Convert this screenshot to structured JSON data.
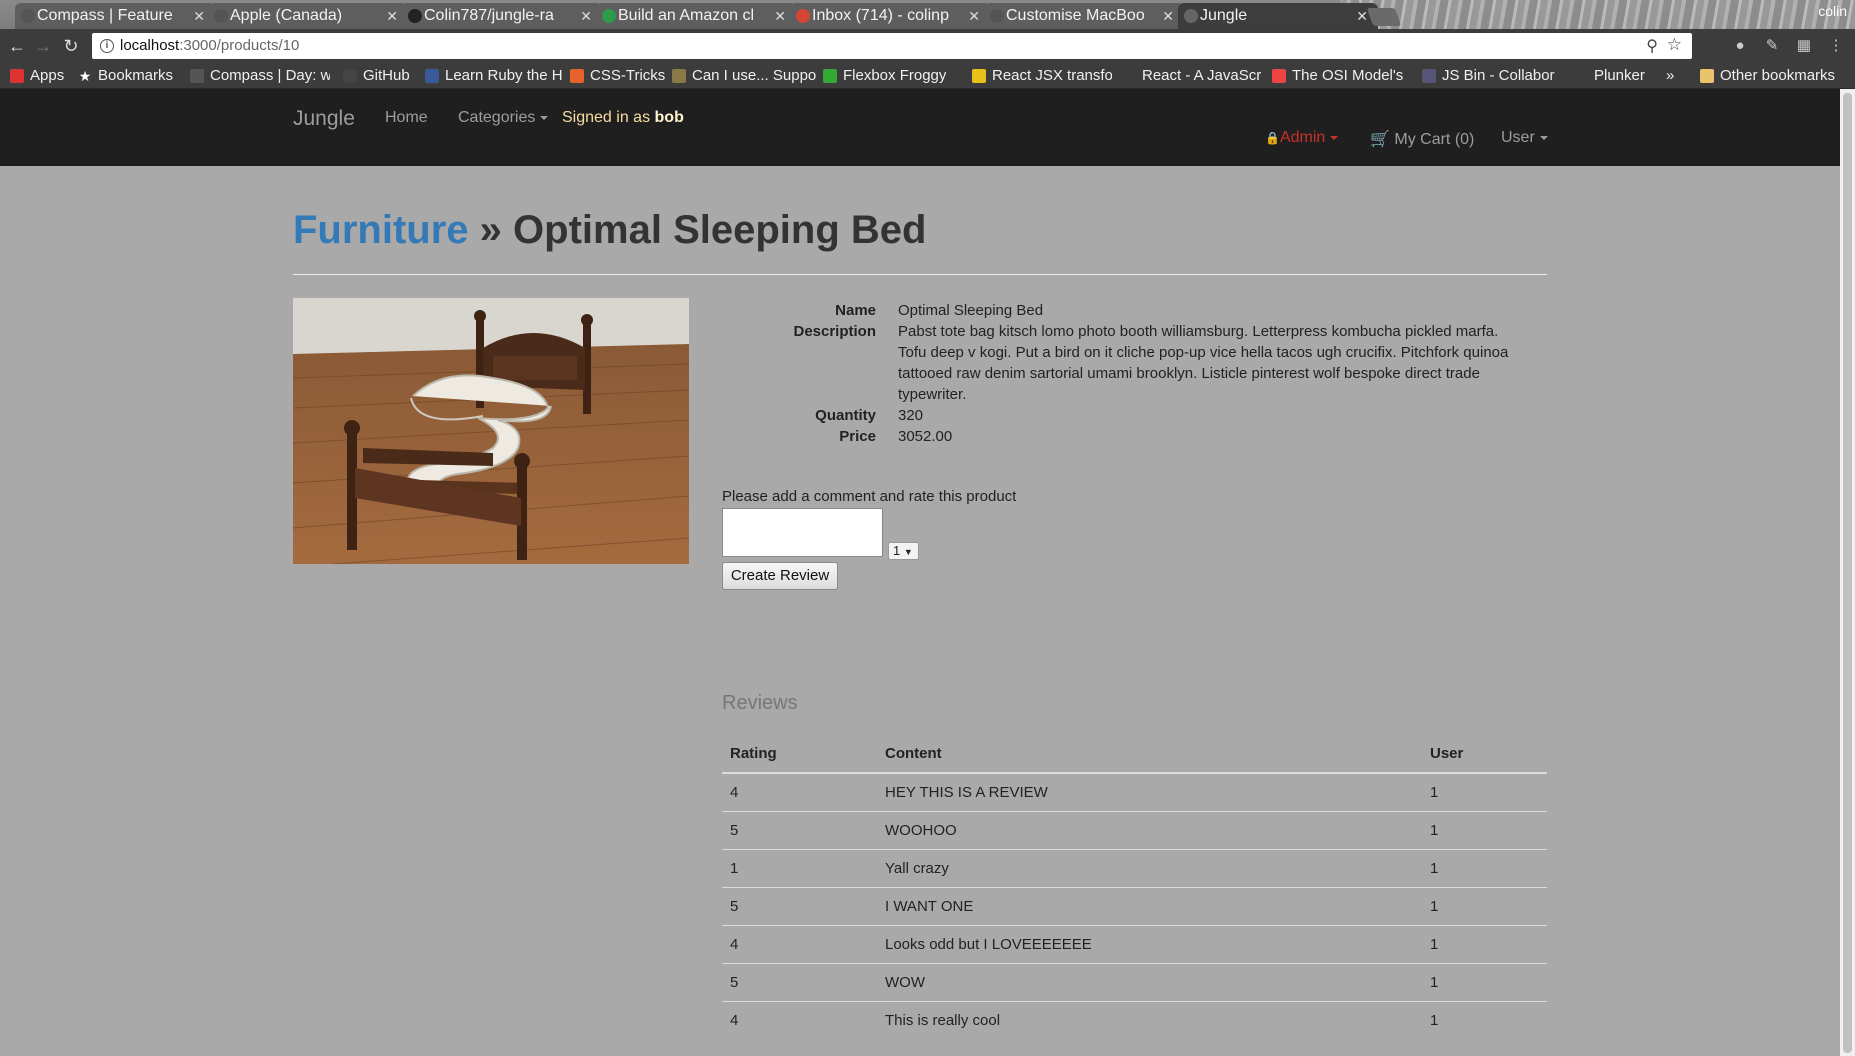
{
  "browser": {
    "tabs": [
      {
        "title": "Compass | Feature",
        "favicon": "compass-icon",
        "color": "#555"
      },
      {
        "title": "Apple (Canada)",
        "favicon": "apple-icon",
        "color": "#555"
      },
      {
        "title": "Colin787/jungle-ra",
        "favicon": "github-icon",
        "color": "#222"
      },
      {
        "title": "Build an Amazon cl",
        "favicon": "udemy-icon",
        "color": "#2c9b4a"
      },
      {
        "title": "Inbox (714) - colinp",
        "favicon": "gmail-icon",
        "color": "#d44638"
      },
      {
        "title": "Customise MacBoo",
        "favicon": "apple-icon",
        "color": "#555"
      },
      {
        "title": "Jungle",
        "favicon": "page-icon",
        "color": "#666"
      }
    ],
    "profile_name": "colin",
    "url_host": "localhost",
    "url_rest": ":3000/products/10",
    "bookmarks": [
      {
        "label": "Apps",
        "icon": "apps-grid-icon",
        "color": "#d33"
      },
      {
        "label": "Bookmarks",
        "icon": "star-icon",
        "color": "#3c3c3c"
      },
      {
        "label": "Compass | Day: w",
        "icon": "compass-icon",
        "color": "#555"
      },
      {
        "label": "GitHub",
        "icon": "github-icon",
        "color": "#444"
      },
      {
        "label": "Learn Ruby the H",
        "icon": "document-icon",
        "color": "#3b5998"
      },
      {
        "label": "CSS-Tricks",
        "icon": "css-tricks-icon",
        "color": "#e8632b"
      },
      {
        "label": "Can I use... Suppo",
        "icon": "caniuse-icon",
        "color": "#8a7a4a"
      },
      {
        "label": "Flexbox Froggy",
        "icon": "frog-icon",
        "color": "#3a3"
      },
      {
        "label": "React JSX transfo",
        "icon": "jsx-icon",
        "color": "#e8c11b"
      },
      {
        "label": "React - A JavaScri",
        "icon": "react-icon",
        "color": "#3c3c3c"
      },
      {
        "label": "The OSI Model's",
        "icon": "windows-icon",
        "color": "#e44"
      },
      {
        "label": "JS Bin - Collabor",
        "icon": "jsbin-icon",
        "color": "#557"
      },
      {
        "label": "Plunker",
        "icon": "plunker-icon",
        "color": "#3c3c3c"
      },
      {
        "label": "»",
        "icon": "",
        "color": ""
      },
      {
        "label": "Other bookmarks",
        "icon": "folder-icon",
        "color": "#e9c46a"
      }
    ]
  },
  "navbar": {
    "brand": "Jungle",
    "home": "Home",
    "categories": "Categories",
    "signed_prefix": "Signed in as",
    "username": "bob",
    "admin": "Admin",
    "cart": "My Cart (0)",
    "user": "User"
  },
  "product": {
    "category": "Furniture",
    "separator": "»",
    "name": "Optimal Sleeping Bed",
    "labels": {
      "name": "Name",
      "description": "Description",
      "quantity": "Quantity",
      "price": "Price"
    },
    "description": "Pabst tote bag kitsch lomo photo booth williamsburg. Letterpress kombucha pickled marfa. Tofu deep v kogi. Put a bird on it cliche pop-up vice hella tacos ugh crucifix. Pitchfork quinoa tattooed raw denim sartorial umami brooklyn. Listicle pinterest wolf bespoke direct trade typewriter.",
    "quantity": "320",
    "price": "3052.00"
  },
  "review_form": {
    "prompt": "Please add a comment and rate this product",
    "comment_value": "",
    "rating_selected": "1",
    "submit": "Create Review"
  },
  "reviews": {
    "title": "Reviews",
    "headers": [
      "Rating",
      "Content",
      "User"
    ],
    "rows": [
      [
        "4",
        "HEY THIS IS A REVIEW",
        "1"
      ],
      [
        "5",
        "WOOHOO",
        "1"
      ],
      [
        "1",
        "Yall crazy",
        "1"
      ],
      [
        "5",
        "I WANT ONE",
        "1"
      ],
      [
        "4",
        "Looks odd but I LOVEEEEEEE",
        "1"
      ],
      [
        "5",
        "WOW",
        "1"
      ],
      [
        "4",
        "This is really cool",
        "1"
      ]
    ]
  },
  "colors": {
    "page_bg": "#a9a9a9",
    "navbar_bg": "#1f1f1f",
    "link_blue": "#337ab7",
    "admin_red": "#c9302c"
  }
}
